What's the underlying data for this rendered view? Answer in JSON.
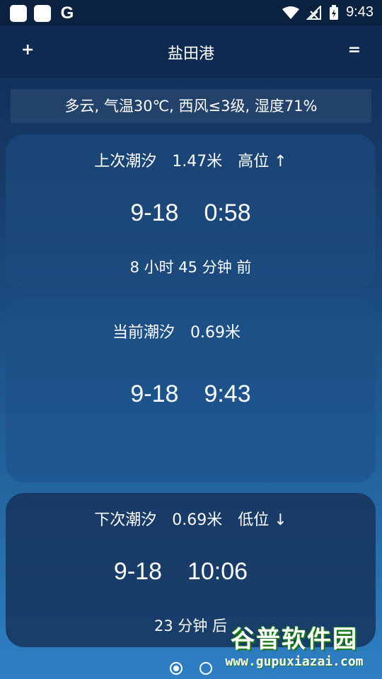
{
  "statusbar": {
    "time": "9:43",
    "g_label": "G"
  },
  "header": {
    "plus": "+",
    "title": "盐田港",
    "menu": "="
  },
  "weather": "多云, 气温30℃, 西风≤3级, 湿度71%",
  "previous_tide": {
    "label": "上次潮汐",
    "height": "1.47米",
    "level": "高位 ↑",
    "date": "9-18",
    "time": "0:58",
    "relative": "8 小时 45 分钟 前"
  },
  "current_tide": {
    "label": "当前潮汐",
    "height": "0.69米",
    "date": "9-18",
    "time": "9:43"
  },
  "next_tide": {
    "label": "下次潮汐",
    "height": "0.69米",
    "level": "低位 ↓",
    "date": "9-18",
    "time": "10:06",
    "relative": "23 分钟 后"
  },
  "watermark": {
    "brand": "谷普软件园",
    "url": "www.gupuxiazai.com"
  }
}
